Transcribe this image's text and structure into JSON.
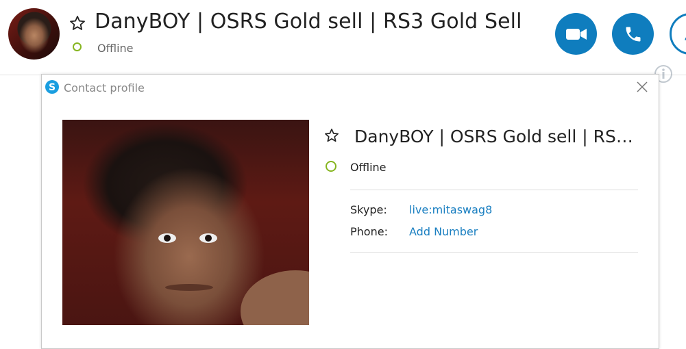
{
  "header": {
    "contact_name": "DanyBOY | OSRS Gold sell | RS3 Gold Sell",
    "status": "Offline"
  },
  "dialog": {
    "title": "Contact profile",
    "profile": {
      "name": "DanyBOY | OSRS Gold sell | RS3...",
      "status": "Offline",
      "fields": [
        {
          "label": "Skype:",
          "value": "live:mitaswag8"
        },
        {
          "label": "Phone:",
          "value": "Add Number"
        }
      ]
    }
  },
  "colors": {
    "accent": "#0f7dbe",
    "status_offline": "#86b520",
    "link": "#1a7fc1"
  },
  "icons": [
    "star-icon",
    "video-call-icon",
    "phone-icon",
    "contact-icon",
    "info-icon",
    "skype-logo-icon",
    "close-icon"
  ]
}
